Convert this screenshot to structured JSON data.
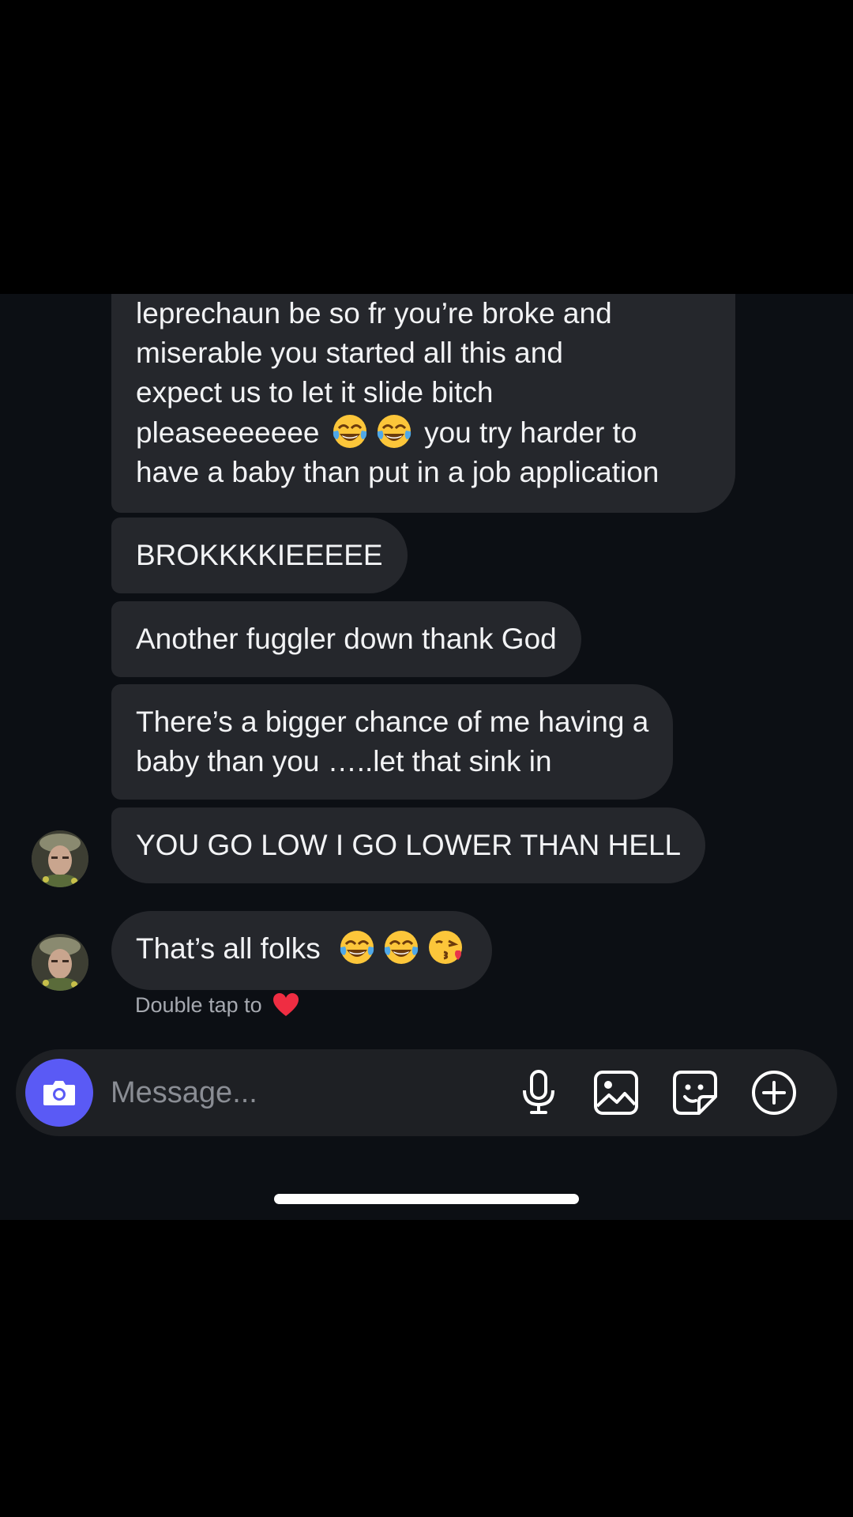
{
  "messages": [
    {
      "lines": [
        "leprechaun be so fr you’re broke and",
        "miserable you started all this and",
        "expect us to let it slide bitch",
        "pleaseeeeeee",
        "you try harder to",
        "have a baby than put in a job application"
      ],
      "emoji_line4": [
        "tears-of-joy-emoji",
        "tears-of-joy-emoji"
      ]
    },
    {
      "text": "BROKKKKIEEEEE"
    },
    {
      "text": "Another fuggler down thank God"
    },
    {
      "lines": [
        "There’s a bigger chance of me having a",
        "baby than you …..let that sink in"
      ]
    },
    {
      "text": "YOU GO LOW I GO LOWER THAN HELL"
    },
    {
      "text": "That’s all folks",
      "emojis": [
        "tears-of-joy-emoji",
        "tears-of-joy-emoji",
        "kissing-face-emoji"
      ]
    }
  ],
  "hint": {
    "text": "Double tap to",
    "icon": "red-heart-icon"
  },
  "composer": {
    "placeholder": "Message...",
    "icons": [
      "camera-icon",
      "microphone-icon",
      "gallery-icon",
      "sticker-icon",
      "plus-icon"
    ],
    "camera_color": "#5a5af5"
  },
  "colors": {
    "background": "#0c0f14",
    "bubble": "#25272c",
    "text": "#f2f3f5"
  }
}
